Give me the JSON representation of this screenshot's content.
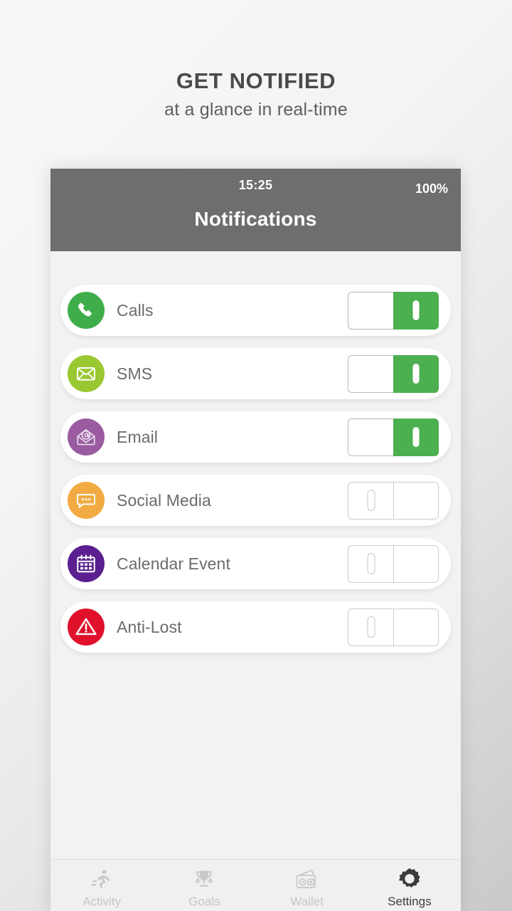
{
  "promo": {
    "title": "GET NOTIFIED",
    "subtitle": "at a glance in real-time"
  },
  "phone": {
    "status": {
      "time": "15:25",
      "battery": "100%"
    },
    "title": "Notifications"
  },
  "notifications": [
    {
      "label": "Calls",
      "icon": "phone-icon",
      "color": "#3fae4a",
      "state": "on"
    },
    {
      "label": "SMS",
      "icon": "envelope-icon",
      "color": "#9ac832",
      "state": "on"
    },
    {
      "label": "Email",
      "icon": "at-mail-icon",
      "color": "#9a5ba0",
      "state": "on"
    },
    {
      "label": "Social Media",
      "icon": "chat-bubble-icon",
      "color": "#f2ab42",
      "state": "off"
    },
    {
      "label": "Calendar Event",
      "icon": "calendar-icon",
      "color": "#5b1f8f",
      "state": "off"
    },
    {
      "label": "Anti-Lost",
      "icon": "warning-icon",
      "color": "#e0112b",
      "state": "off"
    }
  ],
  "nav": [
    {
      "label": "Activity",
      "icon": "runner-icon",
      "active": false
    },
    {
      "label": "Goals",
      "icon": "trophy-icon",
      "active": false
    },
    {
      "label": "Wallet",
      "icon": "wallet-icon",
      "active": false
    },
    {
      "label": "Settings",
      "icon": "gear-icon",
      "active": true
    }
  ],
  "colors": {
    "accent_on": "#4caf50",
    "appbar": "#6e6e6e",
    "screen_bg": "#f2f2f2",
    "label_text": "#6b6b6f"
  }
}
